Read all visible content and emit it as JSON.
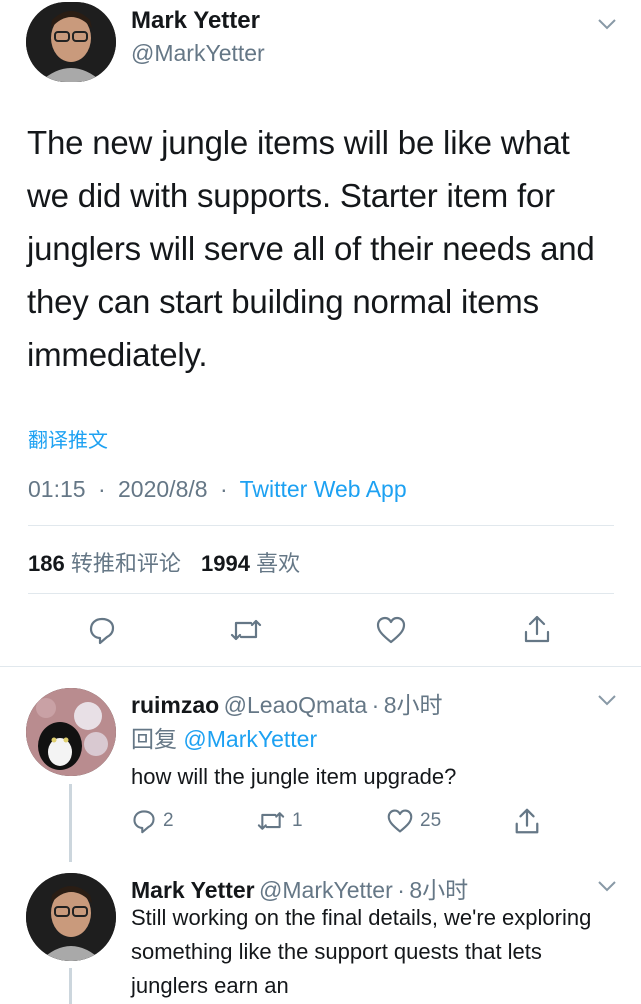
{
  "main_tweet": {
    "author_name": "Mark Yetter",
    "handle": "@MarkYetter",
    "text": "The new jungle items will be like what we did with supports. Starter item for junglers will serve all of their needs and they can start building normal items immediately.",
    "translate": "翻译推文",
    "time": "01:15",
    "date": "2020/8/8",
    "source": "Twitter Web App",
    "retweets_count": "186",
    "retweets_label": "转推和评论",
    "likes_count": "1994",
    "likes_label": "喜欢",
    "sep": "·"
  },
  "replies": [
    {
      "author_name": "ruimzao",
      "handle": "@LeaoQmata",
      "age": "8小时",
      "reply_to_label": "回复",
      "reply_to_handle": "@MarkYetter",
      "text": "how will the jungle item upgrade?",
      "reply_count": "2",
      "retweet_count": "1",
      "like_count": "25"
    },
    {
      "author_name": "Mark Yetter",
      "handle": "@MarkYetter",
      "age": "8小时",
      "text": "Still working on the final details, we're exploring something like the support quests that lets junglers earn an"
    }
  ],
  "colors": {
    "link": "#1da1f2",
    "secondary": "#657786",
    "divider": "#e1e8ed"
  }
}
